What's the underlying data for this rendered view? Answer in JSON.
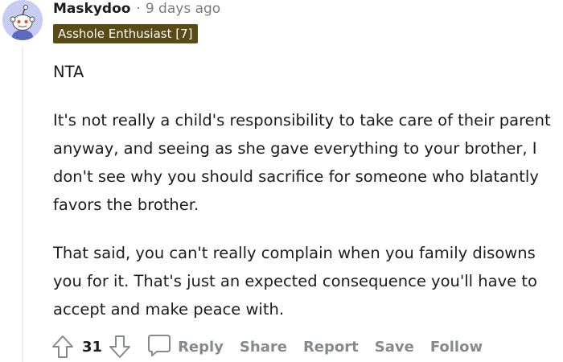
{
  "comment": {
    "author": "Maskydoo",
    "separator": "·",
    "time_ago": "9 days ago",
    "flair": "Asshole Enthusiast [7]",
    "paragraphs": [
      "NTA",
      "It's not really a child's responsibility to take care of their parent anyway, and seeing as she gave everything to your brother, I don't see why you should sacrifice for someone who blatantly favors the brother.",
      "That said, you can't really complain when you family disowns you for it. That's just an expected consequence you'll have to accept and make peace with."
    ],
    "score": "31",
    "actions": {
      "reply": "Reply",
      "share": "Share",
      "report": "Report",
      "save": "Save",
      "follow": "Follow"
    }
  },
  "colors": {
    "avatar_bg": "#c8cbf2",
    "flair_bg": "#5a4a16",
    "muted_text": "#7c7c7c",
    "action_text": "#878a8c"
  },
  "icons": {
    "avatar": "snoo-avatar-icon",
    "upvote": "upvote-arrow-icon",
    "downvote": "downvote-arrow-icon",
    "reply": "comment-bubble-icon"
  }
}
